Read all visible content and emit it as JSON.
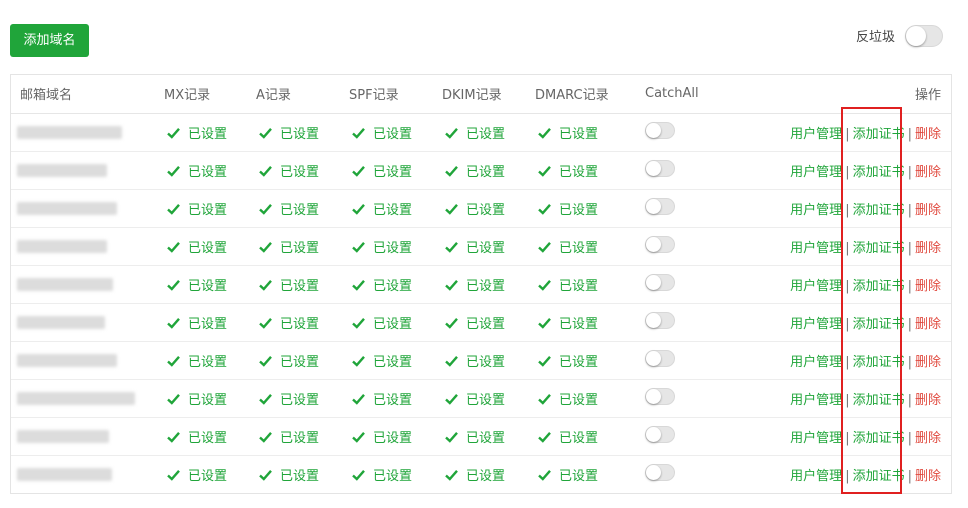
{
  "toolbar": {
    "add_domain_label": "添加域名",
    "spam_label": "反垃圾"
  },
  "table": {
    "headers": {
      "domain": "邮箱域名",
      "mx": "MX记录",
      "a": "A记录",
      "spf": "SPF记录",
      "dkim": "DKIM记录",
      "dmarc": "DMARC记录",
      "catchall": "CatchAll",
      "ops": "操作"
    },
    "status_text": "已设置",
    "ops": {
      "user_mgmt": "用户管理",
      "add_cert": "添加证书",
      "delete": "删除",
      "separator": "|"
    },
    "rows": [
      {
        "mx": "已设置",
        "a": "已设置",
        "spf": "已设置",
        "dkim": "已设置",
        "dmarc": "已设置",
        "catchall": false
      },
      {
        "mx": "已设置",
        "a": "已设置",
        "spf": "已设置",
        "dkim": "已设置",
        "dmarc": "已设置",
        "catchall": false
      },
      {
        "mx": "已设置",
        "a": "已设置",
        "spf": "已设置",
        "dkim": "已设置",
        "dmarc": "已设置",
        "catchall": false
      },
      {
        "mx": "已设置",
        "a": "已设置",
        "spf": "已设置",
        "dkim": "已设置",
        "dmarc": "已设置",
        "catchall": false
      },
      {
        "mx": "已设置",
        "a": "已设置",
        "spf": "已设置",
        "dkim": "已设置",
        "dmarc": "已设置",
        "catchall": false
      },
      {
        "mx": "已设置",
        "a": "已设置",
        "spf": "已设置",
        "dkim": "已设置",
        "dmarc": "已设置",
        "catchall": false
      },
      {
        "mx": "已设置",
        "a": "已设置",
        "spf": "已设置",
        "dkim": "已设置",
        "dmarc": "已设置",
        "catchall": false
      },
      {
        "mx": "已设置",
        "a": "已设置",
        "spf": "已设置",
        "dkim": "已设置",
        "dmarc": "已设置",
        "catchall": false
      },
      {
        "mx": "已设置",
        "a": "已设置",
        "spf": "已设置",
        "dkim": "已设置",
        "dmarc": "已设置",
        "catchall": false
      },
      {
        "mx": "已设置",
        "a": "已设置",
        "spf": "已设置",
        "dkim": "已设置",
        "dmarc": "已设置",
        "catchall": false
      }
    ]
  },
  "colors": {
    "accent": "#20a53a",
    "danger": "#e0493e",
    "highlight": "#e02020"
  },
  "spam_filter_enabled": false
}
